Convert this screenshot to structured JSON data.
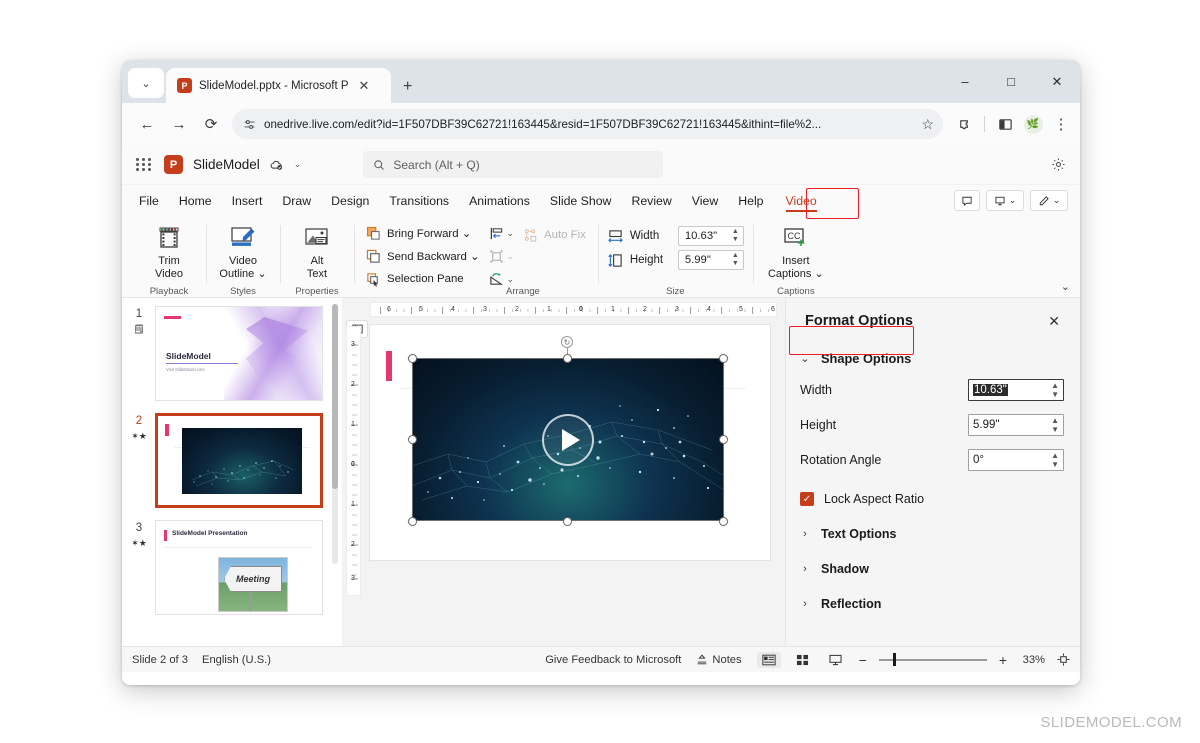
{
  "browser": {
    "tab": {
      "title": "SlideModel.pptx - Microsoft Po",
      "icon": "powerpoint-icon",
      "close": "✕"
    },
    "new_tab": "+",
    "tab_list_chevron": "⌄",
    "window_controls": {
      "minimize": "–",
      "maximize": "□",
      "close": "✕"
    },
    "nav": {
      "back": "←",
      "forward": "→",
      "reload": "⟳"
    },
    "url": "onedrive.live.com/edit?id=1F507DBF39C62721!163445&resid=1F507DBF39C62721!163445&ithint=file%2...",
    "bookmark": "☆",
    "toolbar_icons": [
      "extensions-icon",
      "split-screen-icon",
      "profile-avatar",
      "browser-menu-icon"
    ],
    "menu_dots": "⋮"
  },
  "app": {
    "waffle": "app-launcher",
    "logo": "P",
    "doc_title": "SlideModel",
    "cloud_status": "saved-to-cloud",
    "title_chevron": "⌄",
    "search_placeholder": "Search (Alt + Q)",
    "settings": "gear-icon"
  },
  "ribbon": {
    "tabs": [
      {
        "label": "File",
        "active": false
      },
      {
        "label": "Home",
        "active": false
      },
      {
        "label": "Insert",
        "active": false
      },
      {
        "label": "Draw",
        "active": false
      },
      {
        "label": "Design",
        "active": false
      },
      {
        "label": "Transitions",
        "active": false
      },
      {
        "label": "Animations",
        "active": false
      },
      {
        "label": "Slide Show",
        "active": false
      },
      {
        "label": "Review",
        "active": false
      },
      {
        "label": "View",
        "active": false
      },
      {
        "label": "Help",
        "active": false
      },
      {
        "label": "Video",
        "active": true
      }
    ],
    "right_buttons": [
      "comments-icon",
      "present-icon",
      "present-chevron",
      "edit-pencil-icon",
      "edit-chevron"
    ],
    "collapse_chevron": "⌄",
    "groups": {
      "playback": {
        "label": "Playback",
        "button": {
          "line1": "Trim",
          "line2": "Video",
          "icon": "trim-video-icon"
        }
      },
      "styles": {
        "label": "Styles",
        "button": {
          "line1": "Video",
          "line2": "Outline ⌄",
          "icon": "video-outline-icon"
        }
      },
      "properties": {
        "label": "Properties",
        "button": {
          "line1": "Alt",
          "line2": "Text",
          "icon": "alt-text-icon"
        }
      },
      "arrange": {
        "label": "Arrange",
        "items": [
          {
            "label": "Bring Forward ⌄",
            "icon": "bring-forward-icon",
            "disabled": false
          },
          {
            "label": "Send Backward ⌄",
            "icon": "send-backward-icon",
            "disabled": false
          },
          {
            "label": "Selection Pane",
            "icon": "selection-pane-icon",
            "disabled": false
          }
        ],
        "mini_items": [
          {
            "icon": "align-objects-icon",
            "chevron": "⌄",
            "disabled": false
          },
          {
            "icon": "group-objects-icon",
            "chevron": "⌄",
            "disabled": true
          },
          {
            "icon": "rotate-objects-icon",
            "chevron": "⌄",
            "disabled": false
          }
        ],
        "auto_fix": {
          "label": "Auto Fix",
          "icon": "auto-fix-icon",
          "disabled": true
        }
      },
      "size": {
        "label": "Size",
        "width_label": "Width",
        "width_value": "10.63\"",
        "height_label": "Height",
        "height_value": "5.99\"",
        "width_icon": "width-icon",
        "height_icon": "height-icon"
      },
      "captions": {
        "label": "Captions",
        "button": {
          "line1": "Insert",
          "line2": "Captions ⌄",
          "icon": "cc-icon"
        }
      }
    }
  },
  "thumbnails": {
    "scrollbar": "thumbnail-scrollbar",
    "slides": [
      {
        "number": "1",
        "markers": "🗒",
        "selected": false,
        "title": "SlideModel",
        "subtitle": "Visit SlideModel.com"
      },
      {
        "number": "2",
        "markers": "✶★",
        "selected": true,
        "title": ""
      },
      {
        "number": "3",
        "markers": "✶★",
        "selected": false,
        "title": "SlideModel Presentation",
        "image_text": "Meeting"
      }
    ]
  },
  "canvas": {
    "outline_toggle": "outline-pane-toggle",
    "hruler_ticks": [
      "6",
      "5",
      "4",
      "3",
      "2",
      "1",
      "0",
      "1",
      "2",
      "3",
      "4",
      "5",
      "6"
    ],
    "vruler_ticks": [
      "3",
      "2",
      "1",
      "0",
      "1",
      "2",
      "3"
    ],
    "video": {
      "play_button": "play-button",
      "rotation_handle": "↻",
      "handles": 8
    }
  },
  "format_pane": {
    "title": "Format Options",
    "close": "✕",
    "section": {
      "chevron": "⌄",
      "label": "Shape Options"
    },
    "rows": [
      {
        "label": "Width",
        "value": "10.63\"",
        "selected": true
      },
      {
        "label": "Height",
        "value": "5.99\"",
        "selected": false
      },
      {
        "label": "Rotation Angle",
        "value": "0°",
        "selected": false
      }
    ],
    "lock_aspect": {
      "label": "Lock Aspect Ratio",
      "checked": true,
      "check": "✓"
    },
    "collapsed_sections": [
      {
        "chevron": "›",
        "label": "Text Options"
      },
      {
        "chevron": "›",
        "label": "Shadow"
      },
      {
        "chevron": "›",
        "label": "Reflection"
      }
    ]
  },
  "statusbar": {
    "slide_count": "Slide 2 of 3",
    "language": "English (U.S.)",
    "feedback": "Give Feedback to Microsoft",
    "notes": "Notes",
    "views": [
      "normal-view-icon",
      "grid-view-icon",
      "presenter-view-icon"
    ],
    "zoom_out": "−",
    "zoom_in": "+",
    "zoom_level": "33%",
    "fit_slide": "fit-to-window-icon"
  },
  "watermark": "SLIDEMODEL.COM",
  "colors": {
    "accent_red": "#c43e1c",
    "highlight_red": "#ee1c25",
    "pink_bar": "#e8376f"
  }
}
